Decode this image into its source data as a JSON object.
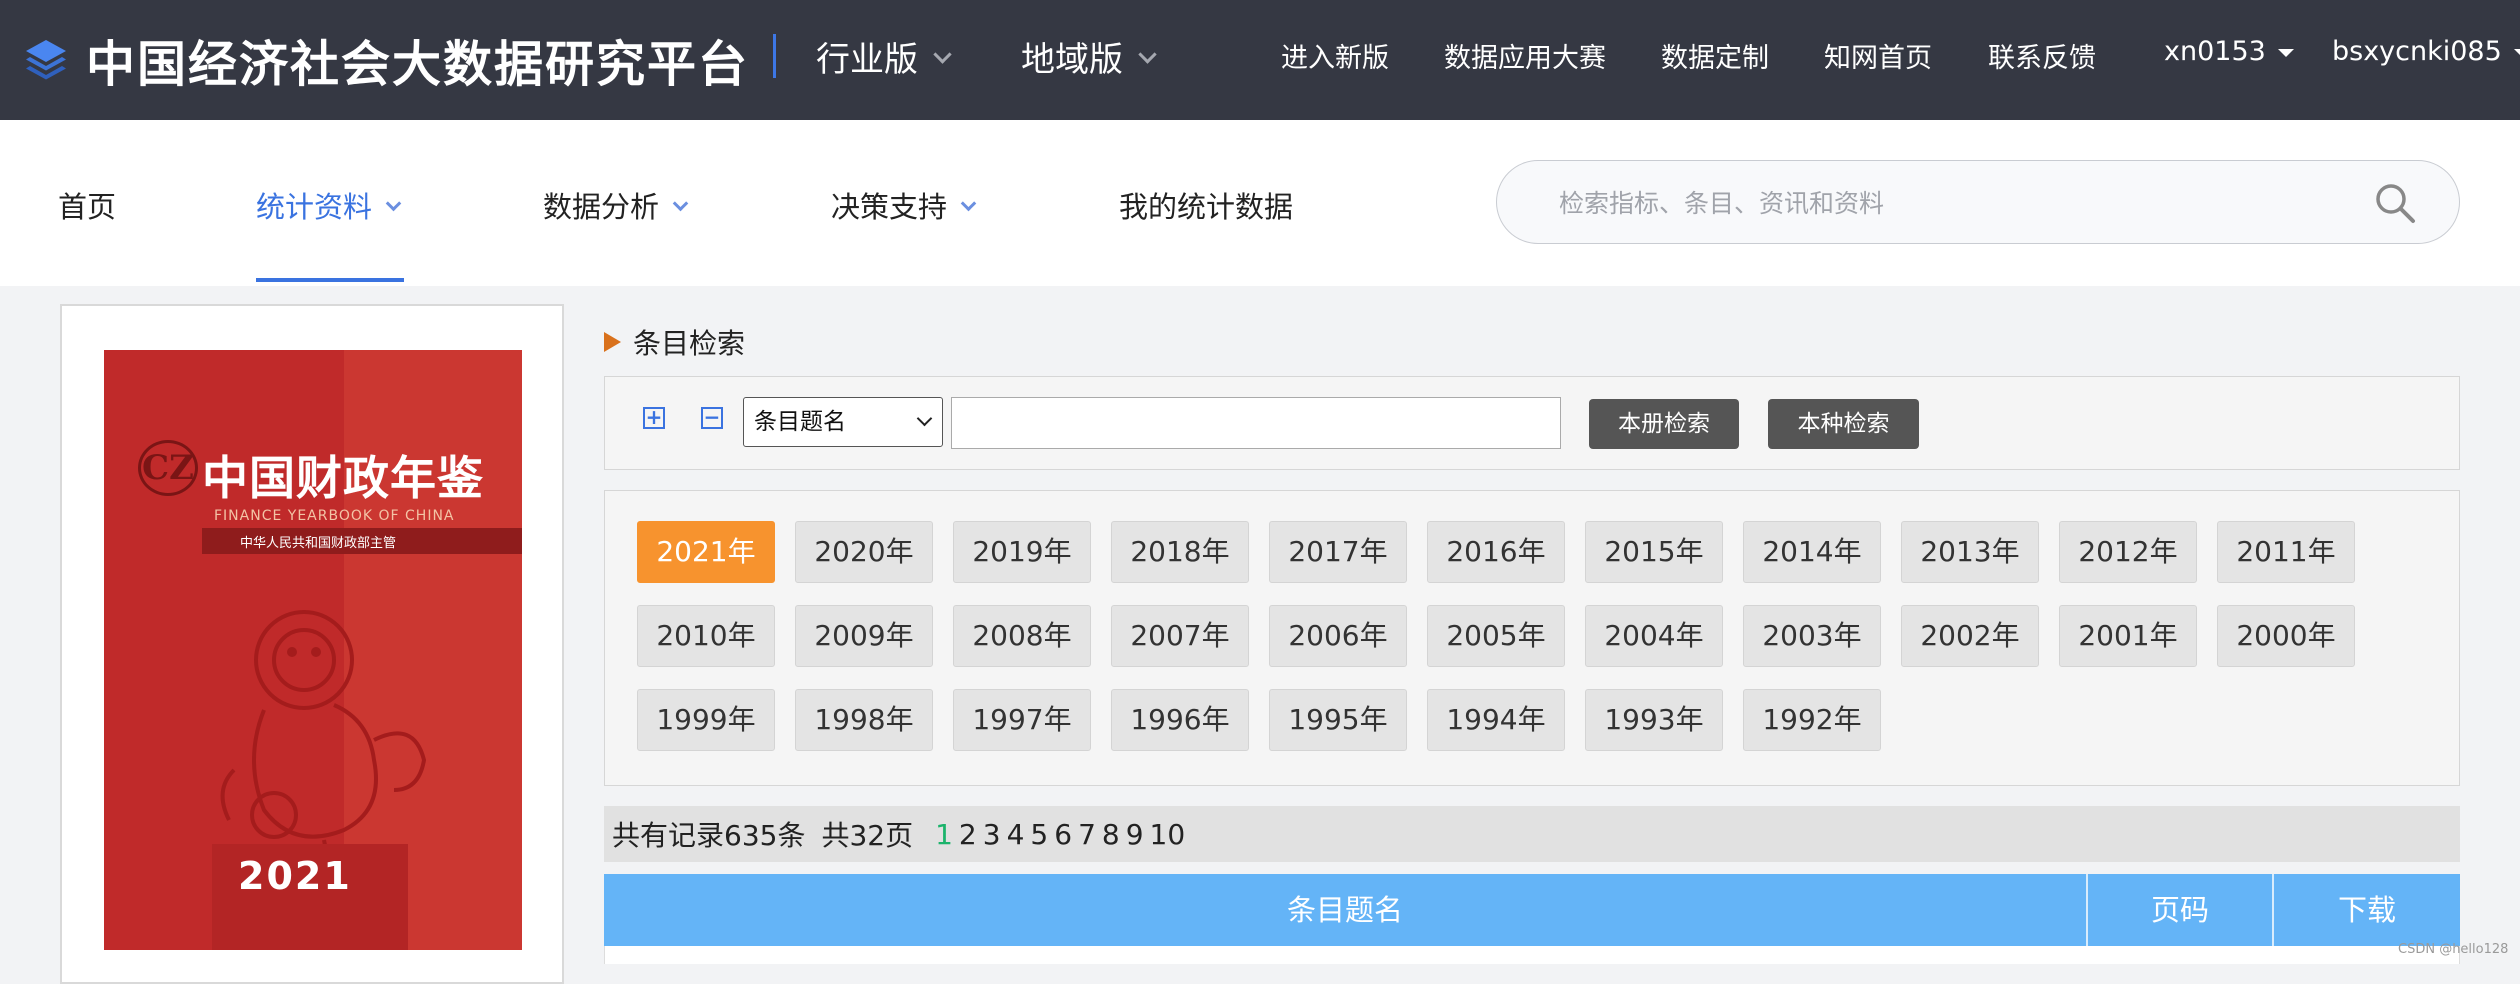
{
  "header": {
    "site_title": "中国经济社会大数据研究平台",
    "editions": [
      "行业版",
      "地域版"
    ],
    "links": [
      "进入新版",
      "数据应用大赛",
      "数据定制",
      "知网首页",
      "联系反馈"
    ],
    "user_menus": [
      "xn0153",
      "bsxycnki085"
    ]
  },
  "nav": {
    "items": [
      {
        "label": "首页"
      },
      {
        "label": "统计资料"
      },
      {
        "label": "数据分析"
      },
      {
        "label": "决策支持"
      },
      {
        "label": "我的统计数据"
      }
    ],
    "active": "统计资料",
    "search_placeholder": "检索指标、条目、资讯和资料"
  },
  "book": {
    "title": "中国财政年鉴",
    "title_en": "FINANCE YEARBOOK OF CHINA",
    "sponsor": "中华人民共和国财政部主管",
    "year": "2021",
    "emblem": "CZ"
  },
  "section": {
    "title": "条目检索",
    "field_selected": "条目题名",
    "buttons": [
      "本册检索",
      "本种检索"
    ]
  },
  "years": [
    "2021年",
    "2020年",
    "2019年",
    "2018年",
    "2017年",
    "2016年",
    "2015年",
    "2014年",
    "2013年",
    "2012年",
    "2011年",
    "2010年",
    "2009年",
    "2008年",
    "2007年",
    "2006年",
    "2005年",
    "2004年",
    "2003年",
    "2002年",
    "2001年",
    "2000年",
    "1999年",
    "1998年",
    "1997年",
    "1996年",
    "1995年",
    "1994年",
    "1993年",
    "1992年"
  ],
  "active_year": "2021年",
  "pager": {
    "records": "共有记录635条",
    "pages_total": "共32页",
    "pages": [
      "1",
      "2",
      "3",
      "4",
      "5",
      "6",
      "7",
      "8",
      "9",
      "10"
    ],
    "current": "1"
  },
  "table": {
    "headers": [
      "条目题名",
      "页码",
      "下载"
    ]
  },
  "watermark": "CSDN @hello128",
  "colors": {
    "topbar": "#353843",
    "accent": "#3a73e0",
    "active_year": "#f7932e",
    "table_header": "#64b4f7",
    "current_page": "#1bb36b"
  }
}
